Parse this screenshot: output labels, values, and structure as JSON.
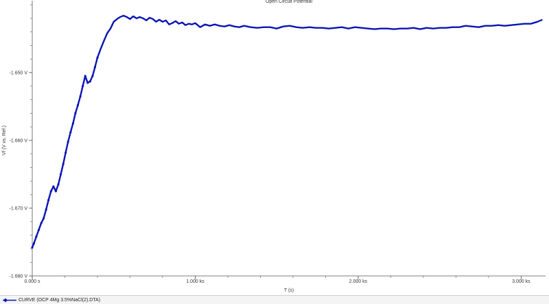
{
  "chart_data": {
    "type": "line",
    "title": "Open Circuit Potential",
    "xlabel": "T (s)",
    "ylabel": "Vf (V vs. Ref.)",
    "xlim": [
      0,
      3150
    ],
    "ylim": [
      -1.68,
      -1.64
    ],
    "x_ticks": [
      0,
      1000,
      2000,
      3000
    ],
    "x_tick_labels": [
      "0.000 s",
      "1.000 ks",
      "2.000 ks",
      "3.000 ks"
    ],
    "y_ticks": [
      -1.68,
      -1.67,
      -1.66,
      -1.65
    ],
    "y_tick_labels": [
      "-1.680 V",
      "-1.670 V",
      "-1.660 V",
      "-1.650 V"
    ],
    "x_minor_step": 200,
    "grid": false,
    "legend_position": "bottom-left",
    "series": [
      {
        "name": "CURVE (OCP  4Mg 3.5%NaCl(2).DTA)",
        "color": "#0a14b4",
        "x": [
          0,
          10,
          25,
          40,
          55,
          70,
          85,
          100,
          115,
          130,
          145,
          160,
          175,
          190,
          205,
          220,
          235,
          250,
          265,
          280,
          295,
          310,
          325,
          340,
          355,
          370,
          385,
          400,
          420,
          440,
          460,
          480,
          500,
          520,
          540,
          560,
          580,
          600,
          620,
          640,
          660,
          680,
          700,
          720,
          740,
          760,
          780,
          800,
          820,
          840,
          860,
          880,
          900,
          920,
          940,
          960,
          980,
          1000,
          1030,
          1060,
          1090,
          1120,
          1150,
          1180,
          1210,
          1240,
          1270,
          1300,
          1340,
          1380,
          1420,
          1460,
          1500,
          1540,
          1580,
          1620,
          1660,
          1700,
          1740,
          1780,
          1820,
          1860,
          1900,
          1940,
          1980,
          2020,
          2060,
          2100,
          2140,
          2180,
          2220,
          2260,
          2300,
          2340,
          2380,
          2420,
          2460,
          2500,
          2540,
          2580,
          2620,
          2660,
          2700,
          2740,
          2780,
          2820,
          2860,
          2900,
          2940,
          2980,
          3020,
          3060,
          3100,
          3130
        ],
        "y": [
          -1.6758,
          -1.6752,
          -1.6742,
          -1.6732,
          -1.6722,
          -1.6715,
          -1.6702,
          -1.6688,
          -1.6675,
          -1.6668,
          -1.6675,
          -1.6665,
          -1.665,
          -1.6635,
          -1.6618,
          -1.6602,
          -1.6588,
          -1.6575,
          -1.656,
          -1.6548,
          -1.6535,
          -1.652,
          -1.6505,
          -1.6515,
          -1.6513,
          -1.6505,
          -1.6492,
          -1.6478,
          -1.6465,
          -1.6453,
          -1.6442,
          -1.6435,
          -1.6425,
          -1.6421,
          -1.6418,
          -1.6416,
          -1.6418,
          -1.6421,
          -1.6417,
          -1.642,
          -1.6418,
          -1.642,
          -1.6423,
          -1.6419,
          -1.6421,
          -1.6425,
          -1.6422,
          -1.6425,
          -1.6423,
          -1.6429,
          -1.6427,
          -1.6424,
          -1.6428,
          -1.6426,
          -1.643,
          -1.6428,
          -1.6429,
          -1.6427,
          -1.6433,
          -1.6429,
          -1.6431,
          -1.6429,
          -1.6431,
          -1.6432,
          -1.643,
          -1.6432,
          -1.6433,
          -1.6431,
          -1.6433,
          -1.6434,
          -1.6433,
          -1.6433,
          -1.6435,
          -1.6432,
          -1.6431,
          -1.6433,
          -1.6434,
          -1.6433,
          -1.6434,
          -1.6434,
          -1.6435,
          -1.6434,
          -1.6433,
          -1.6435,
          -1.6433,
          -1.6434,
          -1.6435,
          -1.6436,
          -1.6435,
          -1.6435,
          -1.6436,
          -1.6435,
          -1.6435,
          -1.6434,
          -1.6436,
          -1.6434,
          -1.6435,
          -1.6434,
          -1.6434,
          -1.6433,
          -1.6433,
          -1.6431,
          -1.6432,
          -1.6433,
          -1.6431,
          -1.6431,
          -1.643,
          -1.6431,
          -1.643,
          -1.6429,
          -1.6428,
          -1.6428,
          -1.6425,
          -1.6422
        ]
      }
    ]
  }
}
